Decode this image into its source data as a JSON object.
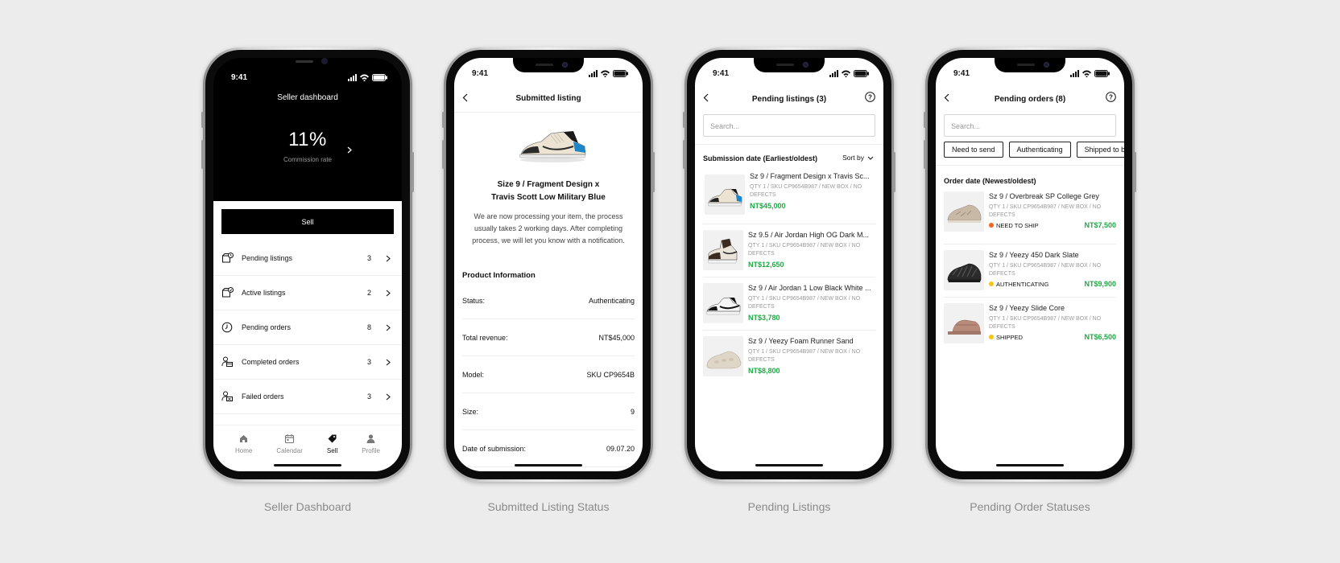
{
  "status_time": "9:41",
  "captions": [
    "Seller Dashboard",
    "Submitted Listing Status",
    "Pending Listings",
    "Pending Order Statuses"
  ],
  "dashboard": {
    "title": "Seller dashboard",
    "commission_value": "11%",
    "commission_label": "Commission rate",
    "sell_button": "Sell",
    "items": [
      {
        "label": "Pending listings",
        "count": "3",
        "icon": "pending-listings-icon"
      },
      {
        "label": "Active listings",
        "count": "2",
        "icon": "active-listings-icon"
      },
      {
        "label": "Pending orders",
        "count": "8",
        "icon": "clock-icon"
      },
      {
        "label": "Completed orders",
        "count": "3",
        "icon": "completed-orders-icon"
      },
      {
        "label": "Failed orders",
        "count": "3",
        "icon": "failed-orders-icon"
      }
    ],
    "tabs": [
      {
        "label": "Home",
        "icon": "home-icon"
      },
      {
        "label": "Calendar",
        "icon": "calendar-icon"
      },
      {
        "label": "Sell",
        "icon": "tag-icon"
      },
      {
        "label": "Profile",
        "icon": "profile-icon"
      }
    ],
    "active_tab": "Sell"
  },
  "submitted": {
    "title": "Submitted listing",
    "product_line1": "Size 9 / Fragment Design x",
    "product_line2": "Travis Scott Low Military Blue",
    "message": "We are now processing your item, the process usually takes 2 working days. After completing process, we will let you know with a notification.",
    "section_title": "Product Information",
    "rows": [
      {
        "label": "Status:",
        "value": "Authenticating"
      },
      {
        "label": "Total revenue:",
        "value": "NT$45,000"
      },
      {
        "label": "Model:",
        "value": "SKU CP9654B"
      },
      {
        "label": "Size:",
        "value": "9"
      },
      {
        "label": "Date of submission:",
        "value": "09.07.20"
      }
    ]
  },
  "pending_listings": {
    "title": "Pending listings (3)",
    "search_placeholder": "Search...",
    "sort_label": "Submission date (Earliest/oldest)",
    "sort_by": "Sort by",
    "items": [
      {
        "title": "Sz 9 / Fragment Design x Travis Sc...",
        "meta": "QTY 1 / SKU CP9654B987 / NEW BOX / NO DEFECTS",
        "price": "NT$45,000"
      },
      {
        "title": "Sz 9.5 / Air Jordan High OG Dark M...",
        "meta": "QTY 1 / SKU CP9654B987 / NEW BOX / NO DEFECTS",
        "price": "NT$12,650"
      },
      {
        "title": "Sz 9 / Air Jordan 1 Low Black White ...",
        "meta": "QTY 1 / SKU CP9654B987 / NEW BOX / NO DEFECTS",
        "price": "NT$3,780"
      },
      {
        "title": "Sz 9 / Yeezy Foam Runner Sand",
        "meta": "QTY 1 / SKU CP9654B987 / NEW BOX / NO DEFECTS",
        "price": "NT$8,800"
      }
    ]
  },
  "pending_orders": {
    "title": "Pending orders (8)",
    "search_placeholder": "Search...",
    "filters": [
      "Need to send",
      "Authenticating",
      "Shipped to buyer"
    ],
    "sort_label": "Order date (Newest/oldest)",
    "items": [
      {
        "title": "Sz 9 / Overbreak SP College Grey",
        "meta": "QTY 1 / SKU CP9654B987 / NEW BOX / NO DEFECTS",
        "status": "NEED TO SHIP",
        "status_color": "#f0661f",
        "price": "NT$7,500"
      },
      {
        "title": "Sz 9 / Yeezy 450 Dark Slate",
        "meta": "QTY 1 / SKU CP9654B987 / NEW BOX / NO DEFECTS",
        "status": "AUTHENTICATING",
        "status_color": "#f5c518",
        "price": "NT$9,900"
      },
      {
        "title": "Sz 9 / Yeezy Slide Core",
        "meta": "QTY 1 / SKU CP9654B987 / NEW BOX / NO DEFECTS",
        "status": "SHIPPED",
        "status_color": "#f5c518",
        "price": "NT$6,500"
      }
    ]
  },
  "colors": {
    "background": "#ececec",
    "price_green": "#1fa845",
    "caption_grey": "#8a8a8a"
  }
}
